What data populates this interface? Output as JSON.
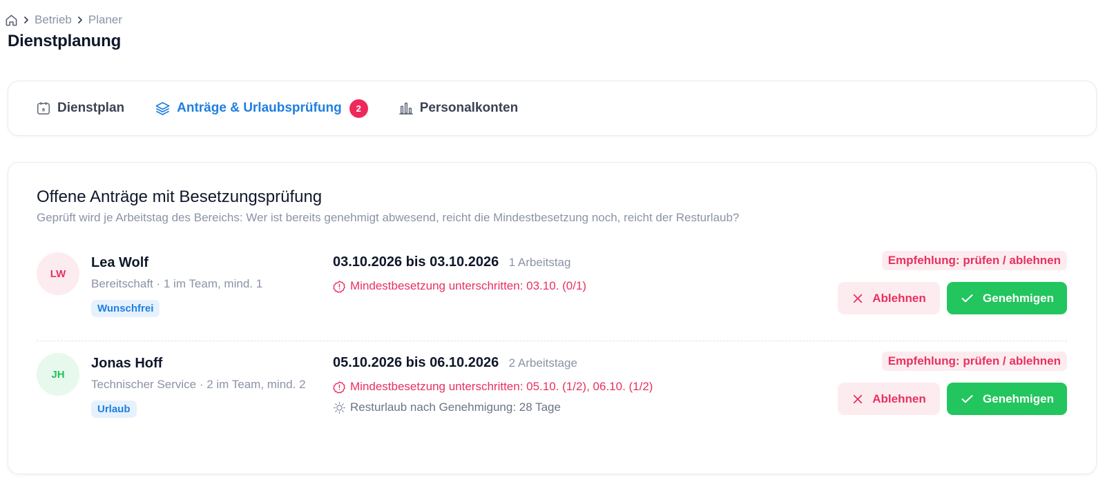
{
  "breadcrumb": {
    "home_icon": "home-icon",
    "items": [
      "Betrieb",
      "Planer"
    ]
  },
  "page": {
    "title": "Dienstplanung"
  },
  "tabs": [
    {
      "label": "Dienstplan",
      "icon": "calendar-icon",
      "active": false
    },
    {
      "label": "Anträge & Urlaubsprüfung",
      "icon": "layers-icon",
      "active": true,
      "badge": "2"
    },
    {
      "label": "Personalkonten",
      "icon": "bar-chart-icon",
      "active": false
    }
  ],
  "section": {
    "title": "Offene Anträge mit Besetzungsprüfung",
    "subtitle": "Geprüft wird je Arbeitstag des Bereichs: Wer ist bereits genehmigt abwesend, reicht die Mindestbesetzung noch, reicht der Resturlaub?"
  },
  "requests": [
    {
      "initials": "LW",
      "name": "Lea Wolf",
      "meta": "Bereitschaft · 1 im Team, mind. 1",
      "tag": "Wunschfrei",
      "date_range": "03.10.2026 bis 03.10.2026",
      "days": "1 Arbeitstag",
      "warning": "Mindestbesetzung unterschritten: 03.10. (0/1)",
      "recommendation": "Empfehlung: prüfen / ablehnen",
      "reject_label": "Ablehnen",
      "approve_label": "Genehmigen"
    },
    {
      "initials": "JH",
      "name": "Jonas Hoff",
      "meta": "Technischer Service · 2 im Team, mind. 2",
      "tag": "Urlaub",
      "date_range": "05.10.2026 bis 06.10.2026",
      "days": "2 Arbeitstage",
      "warning": "Mindestbesetzung unterschritten: 05.10. (1/2), 06.10. (1/2)",
      "info": "Resturlaub nach Genehmigung: 28 Tage",
      "recommendation": "Empfehlung: prüfen / ablehnen",
      "reject_label": "Ablehnen",
      "approve_label": "Genehmigen"
    }
  ],
  "colors": {
    "accent_blue": "#1e7fe0",
    "danger": "#e8305f",
    "success": "#22c55e",
    "badge": "#f0285a"
  }
}
